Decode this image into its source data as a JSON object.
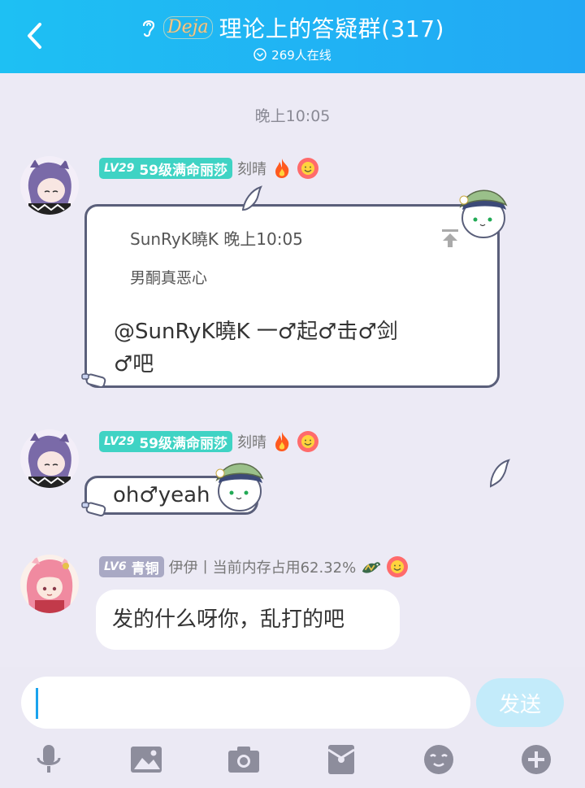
{
  "header": {
    "title": "理论上的答疑群(317)",
    "logo_text": "Deja",
    "online": "269人在线"
  },
  "time_label": "晚上10:05",
  "messages": [
    {
      "badge_level": "LV29",
      "badge_title": "59级满命丽莎",
      "nickname": "刻晴",
      "reply_author": "SunRyK曉K  晚上10:05",
      "reply_text": "男酮真恶心",
      "text_line1": "@SunRyK曉K 一♂起♂击♂剑",
      "text_line2": "♂吧"
    },
    {
      "badge_level": "LV29",
      "badge_title": "59级满命丽莎",
      "nickname": "刻晴",
      "text": "oh♂yeah"
    },
    {
      "badge_level": "LV6",
      "badge_title": "青铜",
      "nickname": "伊伊丨当前内存占用62.32%",
      "text": "发的什么呀你，乱打的吧"
    }
  ],
  "input": {
    "value": "",
    "send_label": "发送"
  },
  "toolbar_icons": [
    "microphone-icon",
    "image-icon",
    "camera-icon",
    "red-packet-icon",
    "emoji-icon",
    "plus-icon"
  ],
  "colors": {
    "header": "#1ec0f3",
    "badge_teal": "#3fd3c4",
    "badge_gray": "#a9a9c4",
    "send_button": "#c3ebfa",
    "caret": "#1aa3ee"
  }
}
